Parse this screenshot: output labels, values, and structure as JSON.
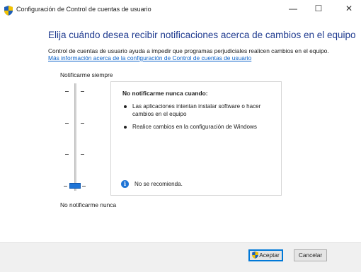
{
  "window": {
    "title": "Configuración de Control de cuentas de usuario",
    "minimize_glyph": "—",
    "maximize_glyph": "☐",
    "close_glyph": "✕",
    "title_icon": "uac-shield-icon"
  },
  "main": {
    "heading": "Elija cuándo desea recibir notificaciones acerca de cambios en el equipo",
    "description": "Control de cuentas de usuario ayuda a impedir que programas perjudiciales realicen cambios en el equipo.",
    "more_link": "Más información acerca de la configuración de Control de cuentas de usuario"
  },
  "slider": {
    "top_label": "Notificarme siempre",
    "bottom_label": "No notificarme nunca",
    "levels": 4,
    "selected_level": 1,
    "accent": "#1e74d6"
  },
  "panel": {
    "title": "No notificarme nunca cuando:",
    "bullets": [
      "Las aplicaciones intentan instalar software o hacer cambios en el equipo",
      "Realice cambios en la configuración de Windows"
    ],
    "info_icon": "info-icon",
    "note": "No se recomienda."
  },
  "footer": {
    "accept_label": "Aceptar",
    "cancel_label": "Cancelar"
  },
  "colors": {
    "heading": "#1e3a8f",
    "link": "#0b62c9",
    "footer_bg": "#f0f0f0"
  }
}
